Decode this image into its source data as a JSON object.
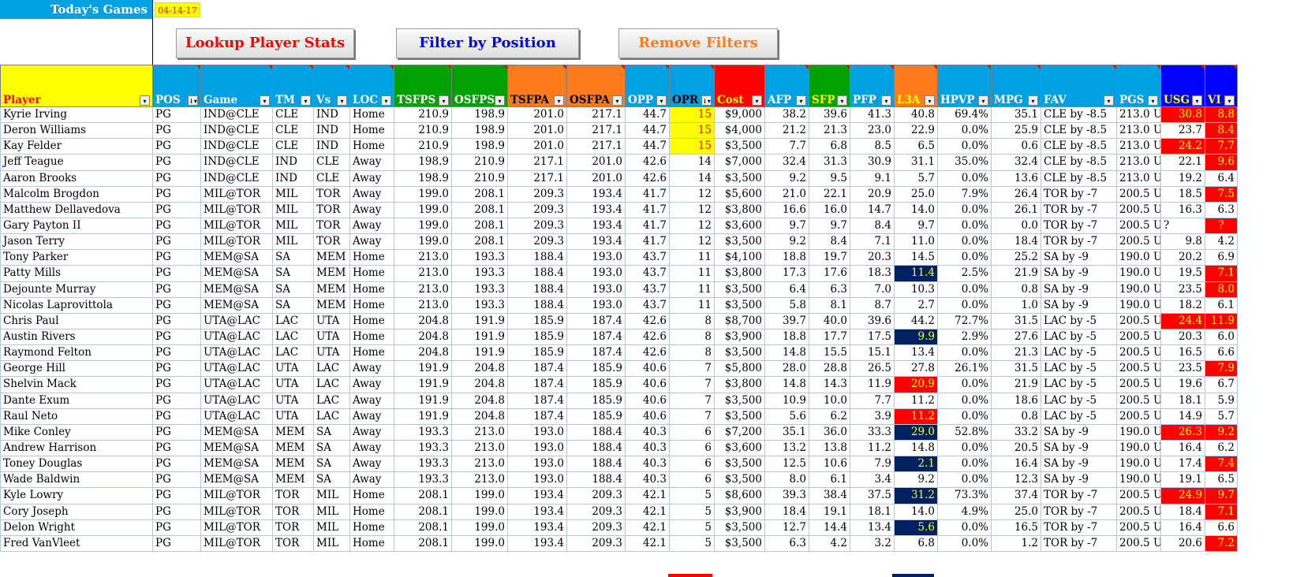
{
  "header": {
    "today_label": "Today's Games",
    "date": "04-14-17"
  },
  "buttons": {
    "lookup": "Lookup Player Stats",
    "filter": "Filter by Position",
    "remove": "Remove Filters"
  },
  "colors": {
    "header_blue": "#00a0e3",
    "header_yellow": "#ffff00",
    "header_green": "#00a000",
    "header_orange": "#ff7a1a",
    "header_red": "#ff0000",
    "header_navy": "#0000ff",
    "highlight_navy": "#002060"
  },
  "columns": [
    {
      "label": "Player",
      "bg": "#ffff00",
      "fg": "#ff0000",
      "w": 193,
      "sort": false
    },
    {
      "label": "POS",
      "bg": "#00a0e3",
      "fg": "#ffffff",
      "w": 61,
      "sort": true
    },
    {
      "label": "Game",
      "bg": "#00a0e3",
      "fg": "#ffffff",
      "w": 91,
      "sort": false
    },
    {
      "label": "TM",
      "bg": "#00a0e3",
      "fg": "#ffffff",
      "w": 52,
      "sort": false
    },
    {
      "label": "Vs",
      "bg": "#00a0e3",
      "fg": "#ffffff",
      "w": 46,
      "sort": false
    },
    {
      "label": "LOC",
      "bg": "#00a0e3",
      "fg": "#ffffff",
      "w": 56,
      "sort": false
    },
    {
      "label": "TSFPS",
      "bg": "#00a000",
      "fg": "#ffffff",
      "w": 73,
      "sort": false
    },
    {
      "label": "OSFPS",
      "bg": "#00a000",
      "fg": "#ffffff",
      "w": 71,
      "sort": false
    },
    {
      "label": "TSFPA",
      "bg": "#ff7a1a",
      "fg": "#000000",
      "w": 75,
      "sort": false
    },
    {
      "label": "OSFPA",
      "bg": "#ff7a1a",
      "fg": "#000000",
      "w": 74,
      "sort": false
    },
    {
      "label": "OPP",
      "bg": "#00a0e3",
      "fg": "#ffffff",
      "w": 56,
      "sort": false
    },
    {
      "label": "OPR",
      "bg": "#00a0e3",
      "fg": "#000000",
      "w": 57,
      "sort": true
    },
    {
      "label": "Cost",
      "bg": "#ff0000",
      "fg": "#ffff00",
      "w": 64,
      "sort": false
    },
    {
      "label": "AFP",
      "bg": "#00a0e3",
      "fg": "#ffffff",
      "w": 56,
      "sort": false
    },
    {
      "label": "SFP",
      "bg": "#00a000",
      "fg": "#ffff00",
      "w": 52,
      "sort": false
    },
    {
      "label": "PFP",
      "bg": "#00a0e3",
      "fg": "#ffffff",
      "w": 56,
      "sort": false
    },
    {
      "label": "L3A",
      "bg": "#ff7a1a",
      "fg": "#ffff00",
      "w": 55,
      "sort": false
    },
    {
      "label": "HPVP",
      "bg": "#00a0e3",
      "fg": "#ffffff",
      "w": 68,
      "sort": false
    },
    {
      "label": "MPG",
      "bg": "#00a0e3",
      "fg": "#ffffff",
      "w": 63,
      "sort": false
    },
    {
      "label": "FAV",
      "bg": "#00a0e3",
      "fg": "#ffffff",
      "w": 96,
      "sort": false
    },
    {
      "label": "PGS",
      "bg": "#00a0e3",
      "fg": "#ffffff",
      "w": 56,
      "sort": false
    },
    {
      "label": "USG",
      "bg": "#0000ff",
      "fg": "#ffff00",
      "w": 56,
      "sort": false
    },
    {
      "label": "VI",
      "bg": "#0000ff",
      "fg": "#ffff00",
      "w": 41,
      "sort": false
    }
  ],
  "rows": [
    {
      "c": [
        "Kyrie Irving",
        "PG",
        "IND@CLE",
        "CLE",
        "IND",
        "Home",
        "210.9",
        "198.9",
        "201.0",
        "217.1",
        "44.7",
        "15",
        "$9,000",
        "38.2",
        "39.6",
        "41.3",
        "40.8",
        "69.4%",
        "35.1",
        "CLE by -8.5",
        "213.0 U",
        "30.8",
        "8.8"
      ],
      "opr": "yellow",
      "l3a": "",
      "usg": "red",
      "vi": "red"
    },
    {
      "c": [
        "Deron Williams",
        "PG",
        "IND@CLE",
        "CLE",
        "IND",
        "Home",
        "210.9",
        "198.9",
        "201.0",
        "217.1",
        "44.7",
        "15",
        "$4,000",
        "21.2",
        "21.3",
        "23.0",
        "22.9",
        "0.0%",
        "25.9",
        "CLE by -8.5",
        "213.0 U",
        "23.7",
        "8.4"
      ],
      "opr": "yellow",
      "l3a": "",
      "usg": "",
      "vi": "red"
    },
    {
      "c": [
        "Kay Felder",
        "PG",
        "IND@CLE",
        "CLE",
        "IND",
        "Home",
        "210.9",
        "198.9",
        "201.0",
        "217.1",
        "44.7",
        "15",
        "$3,500",
        "7.7",
        "6.8",
        "8.5",
        "6.5",
        "0.0%",
        "0.6",
        "CLE by -8.5",
        "213.0 U",
        "24.2",
        "7.7"
      ],
      "opr": "yellow",
      "l3a": "",
      "usg": "red",
      "vi": "red"
    },
    {
      "c": [
        "Jeff Teague",
        "PG",
        "IND@CLE",
        "IND",
        "CLE",
        "Away",
        "198.9",
        "210.9",
        "217.1",
        "201.0",
        "42.6",
        "14",
        "$7,000",
        "32.4",
        "31.3",
        "30.9",
        "31.1",
        "35.0%",
        "32.4",
        "CLE by -8.5",
        "213.0 U",
        "22.1",
        "9.6"
      ],
      "opr": "",
      "l3a": "",
      "usg": "",
      "vi": "red"
    },
    {
      "c": [
        "Aaron Brooks",
        "PG",
        "IND@CLE",
        "IND",
        "CLE",
        "Away",
        "198.9",
        "210.9",
        "217.1",
        "201.0",
        "42.6",
        "14",
        "$3,500",
        "9.2",
        "9.5",
        "9.1",
        "5.7",
        "0.0%",
        "13.6",
        "CLE by -8.5",
        "213.0 U",
        "19.2",
        "6.4"
      ],
      "opr": "",
      "l3a": "",
      "usg": "",
      "vi": ""
    },
    {
      "c": [
        "Malcolm Brogdon",
        "PG",
        "MIL@TOR",
        "MIL",
        "TOR",
        "Away",
        "199.0",
        "208.1",
        "209.3",
        "193.4",
        "41.7",
        "12",
        "$5,600",
        "21.0",
        "22.1",
        "20.9",
        "25.0",
        "7.9%",
        "26.4",
        "TOR by -7",
        "200.5 U",
        "18.5",
        "7.5"
      ],
      "opr": "",
      "l3a": "",
      "usg": "",
      "vi": "red"
    },
    {
      "c": [
        "Matthew Dellavedova",
        "PG",
        "MIL@TOR",
        "MIL",
        "TOR",
        "Away",
        "199.0",
        "208.1",
        "209.3",
        "193.4",
        "41.7",
        "12",
        "$3,800",
        "16.6",
        "16.0",
        "14.7",
        "14.0",
        "0.0%",
        "26.1",
        "TOR by -7",
        "200.5 U",
        "16.3",
        "6.3"
      ],
      "opr": "",
      "l3a": "",
      "usg": "",
      "vi": ""
    },
    {
      "c": [
        "Gary Payton II",
        "PG",
        "MIL@TOR",
        "MIL",
        "TOR",
        "Away",
        "199.0",
        "208.1",
        "209.3",
        "193.4",
        "41.7",
        "12",
        "$3,600",
        "9.7",
        "9.7",
        "8.4",
        "9.7",
        "0.0%",
        "0.0",
        "TOR by -7",
        "200.5 U",
        "?",
        "?"
      ],
      "opr": "",
      "l3a": "",
      "usg": "plain-left",
      "vi": "red-center"
    },
    {
      "c": [
        "Jason Terry",
        "PG",
        "MIL@TOR",
        "MIL",
        "TOR",
        "Away",
        "199.0",
        "208.1",
        "209.3",
        "193.4",
        "41.7",
        "12",
        "$3,500",
        "9.2",
        "8.4",
        "7.1",
        "11.0",
        "0.0%",
        "18.4",
        "TOR by -7",
        "200.5 U",
        "9.8",
        "4.2"
      ],
      "opr": "",
      "l3a": "",
      "usg": "",
      "vi": ""
    },
    {
      "c": [
        "Tony Parker",
        "PG",
        "MEM@SA",
        "SA",
        "MEM",
        "Home",
        "213.0",
        "193.3",
        "188.4",
        "193.0",
        "43.7",
        "11",
        "$4,100",
        "18.8",
        "19.7",
        "20.3",
        "14.5",
        "0.0%",
        "25.2",
        "SA by -9",
        "190.0 U",
        "20.2",
        "6.9"
      ],
      "opr": "",
      "l3a": "",
      "usg": "",
      "vi": ""
    },
    {
      "c": [
        "Patty Mills",
        "PG",
        "MEM@SA",
        "SA",
        "MEM",
        "Home",
        "213.0",
        "193.3",
        "188.4",
        "193.0",
        "43.7",
        "11",
        "$3,800",
        "17.3",
        "17.6",
        "18.3",
        "11.4",
        "2.5%",
        "21.9",
        "SA by -9",
        "190.0 U",
        "19.5",
        "7.1"
      ],
      "opr": "",
      "l3a": "navy",
      "usg": "",
      "vi": "red"
    },
    {
      "c": [
        "Dejounte Murray",
        "PG",
        "MEM@SA",
        "SA",
        "MEM",
        "Home",
        "213.0",
        "193.3",
        "188.4",
        "193.0",
        "43.7",
        "11",
        "$3,500",
        "6.4",
        "6.3",
        "7.0",
        "10.3",
        "0.0%",
        "0.8",
        "SA by -9",
        "190.0 U",
        "23.5",
        "8.0"
      ],
      "opr": "",
      "l3a": "",
      "usg": "",
      "vi": "red"
    },
    {
      "c": [
        "Nicolas Laprovittola",
        "PG",
        "MEM@SA",
        "SA",
        "MEM",
        "Home",
        "213.0",
        "193.3",
        "188.4",
        "193.0",
        "43.7",
        "11",
        "$3,500",
        "5.8",
        "8.1",
        "8.7",
        "2.7",
        "0.0%",
        "1.0",
        "SA by -9",
        "190.0 U",
        "18.2",
        "6.1"
      ],
      "opr": "",
      "l3a": "",
      "usg": "",
      "vi": ""
    },
    {
      "c": [
        "Chris Paul",
        "PG",
        "UTA@LAC",
        "LAC",
        "UTA",
        "Home",
        "204.8",
        "191.9",
        "185.9",
        "187.4",
        "42.6",
        "8",
        "$8,700",
        "39.7",
        "40.0",
        "39.6",
        "44.2",
        "72.7%",
        "31.5",
        "LAC by -5",
        "200.5 U",
        "24.4",
        "11.9"
      ],
      "opr": "",
      "l3a": "",
      "usg": "red",
      "vi": "red"
    },
    {
      "c": [
        "Austin Rivers",
        "PG",
        "UTA@LAC",
        "LAC",
        "UTA",
        "Home",
        "204.8",
        "191.9",
        "185.9",
        "187.4",
        "42.6",
        "8",
        "$3,900",
        "18.8",
        "17.7",
        "17.5",
        "9.9",
        "2.9%",
        "27.6",
        "LAC by -5",
        "200.5 U",
        "20.3",
        "6.0"
      ],
      "opr": "",
      "l3a": "navy",
      "usg": "",
      "vi": ""
    },
    {
      "c": [
        "Raymond Felton",
        "PG",
        "UTA@LAC",
        "LAC",
        "UTA",
        "Home",
        "204.8",
        "191.9",
        "185.9",
        "187.4",
        "42.6",
        "8",
        "$3,500",
        "14.8",
        "15.5",
        "15.1",
        "13.4",
        "0.0%",
        "21.3",
        "LAC by -5",
        "200.5 U",
        "16.5",
        "6.6"
      ],
      "opr": "",
      "l3a": "",
      "usg": "",
      "vi": ""
    },
    {
      "c": [
        "George Hill",
        "PG",
        "UTA@LAC",
        "UTA",
        "LAC",
        "Away",
        "191.9",
        "204.8",
        "187.4",
        "185.9",
        "40.6",
        "7",
        "$5,800",
        "28.0",
        "28.8",
        "26.5",
        "27.8",
        "26.1%",
        "31.5",
        "LAC by -5",
        "200.5 U",
        "23.5",
        "7.9"
      ],
      "opr": "",
      "l3a": "",
      "usg": "",
      "vi": "red"
    },
    {
      "c": [
        "Shelvin Mack",
        "PG",
        "UTA@LAC",
        "UTA",
        "LAC",
        "Away",
        "191.9",
        "204.8",
        "187.4",
        "185.9",
        "40.6",
        "7",
        "$3,800",
        "14.8",
        "14.3",
        "11.9",
        "20.9",
        "0.0%",
        "21.9",
        "LAC by -5",
        "200.5 U",
        "19.6",
        "6.7"
      ],
      "opr": "",
      "l3a": "red",
      "usg": "",
      "vi": ""
    },
    {
      "c": [
        "Dante Exum",
        "PG",
        "UTA@LAC",
        "UTA",
        "LAC",
        "Away",
        "191.9",
        "204.8",
        "187.4",
        "185.9",
        "40.6",
        "7",
        "$3,500",
        "10.9",
        "10.0",
        "7.7",
        "11.2",
        "0.0%",
        "18.6",
        "LAC by -5",
        "200.5 U",
        "18.1",
        "5.9"
      ],
      "opr": "",
      "l3a": "",
      "usg": "",
      "vi": ""
    },
    {
      "c": [
        "Raul Neto",
        "PG",
        "UTA@LAC",
        "UTA",
        "LAC",
        "Away",
        "191.9",
        "204.8",
        "187.4",
        "185.9",
        "40.6",
        "7",
        "$3,500",
        "5.6",
        "6.2",
        "3.9",
        "11.2",
        "0.0%",
        "0.8",
        "LAC by -5",
        "200.5 U",
        "14.9",
        "5.7"
      ],
      "opr": "",
      "l3a": "red",
      "usg": "",
      "vi": ""
    },
    {
      "c": [
        "Mike Conley",
        "PG",
        "MEM@SA",
        "MEM",
        "SA",
        "Away",
        "193.3",
        "213.0",
        "193.0",
        "188.4",
        "40.3",
        "6",
        "$7,200",
        "35.1",
        "36.0",
        "33.3",
        "29.0",
        "52.8%",
        "33.2",
        "SA by -9",
        "190.0 U",
        "26.3",
        "9.2"
      ],
      "opr": "",
      "l3a": "navy",
      "usg": "red",
      "vi": "red"
    },
    {
      "c": [
        "Andrew Harrison",
        "PG",
        "MEM@SA",
        "MEM",
        "SA",
        "Away",
        "193.3",
        "213.0",
        "193.0",
        "188.4",
        "40.3",
        "6",
        "$3,600",
        "13.2",
        "13.8",
        "11.2",
        "14.8",
        "0.0%",
        "20.5",
        "SA by -9",
        "190.0 U",
        "16.4",
        "6.2"
      ],
      "opr": "",
      "l3a": "",
      "usg": "",
      "vi": ""
    },
    {
      "c": [
        "Toney Douglas",
        "PG",
        "MEM@SA",
        "MEM",
        "SA",
        "Away",
        "193.3",
        "213.0",
        "193.0",
        "188.4",
        "40.3",
        "6",
        "$3,500",
        "12.5",
        "10.6",
        "7.9",
        "2.1",
        "0.0%",
        "16.4",
        "SA by -9",
        "190.0 U",
        "17.4",
        "7.4"
      ],
      "opr": "",
      "l3a": "navy",
      "usg": "",
      "vi": "red"
    },
    {
      "c": [
        "Wade Baldwin",
        "PG",
        "MEM@SA",
        "MEM",
        "SA",
        "Away",
        "193.3",
        "213.0",
        "193.0",
        "188.4",
        "40.3",
        "6",
        "$3,500",
        "8.0",
        "6.1",
        "3.4",
        "9.2",
        "0.0%",
        "12.3",
        "SA by -9",
        "190.0 U",
        "19.1",
        "6.5"
      ],
      "opr": "",
      "l3a": "",
      "usg": "",
      "vi": ""
    },
    {
      "c": [
        "Kyle Lowry",
        "PG",
        "MIL@TOR",
        "TOR",
        "MIL",
        "Home",
        "208.1",
        "199.0",
        "193.4",
        "209.3",
        "42.1",
        "5",
        "$8,600",
        "39.3",
        "38.4",
        "37.5",
        "31.2",
        "73.3%",
        "37.4",
        "TOR by -7",
        "200.5 U",
        "24.9",
        "9.7"
      ],
      "opr": "",
      "l3a": "navy",
      "usg": "red",
      "vi": "red"
    },
    {
      "c": [
        "Cory Joseph",
        "PG",
        "MIL@TOR",
        "TOR",
        "MIL",
        "Home",
        "208.1",
        "199.0",
        "193.4",
        "209.3",
        "42.1",
        "5",
        "$3,900",
        "18.4",
        "19.1",
        "18.1",
        "14.0",
        "4.9%",
        "25.0",
        "TOR by -7",
        "200.5 U",
        "18.4",
        "7.1"
      ],
      "opr": "",
      "l3a": "",
      "usg": "",
      "vi": "red"
    },
    {
      "c": [
        "Delon Wright",
        "PG",
        "MIL@TOR",
        "TOR",
        "MIL",
        "Home",
        "208.1",
        "199.0",
        "193.4",
        "209.3",
        "42.1",
        "5",
        "$3,500",
        "12.7",
        "14.4",
        "13.4",
        "5.6",
        "0.0%",
        "16.5",
        "TOR by -7",
        "200.5 U",
        "16.4",
        "6.6"
      ],
      "opr": "",
      "l3a": "navy",
      "usg": "",
      "vi": ""
    },
    {
      "c": [
        "Fred VanVleet",
        "PG",
        "MIL@TOR",
        "TOR",
        "MIL",
        "Home",
        "208.1",
        "199.0",
        "193.4",
        "209.3",
        "42.1",
        "5",
        "$3,500",
        "6.3",
        "4.2",
        "3.2",
        "6.8",
        "0.0%",
        "1.2",
        "TOR by -7",
        "200.5 U",
        "20.6",
        "7.2"
      ],
      "opr": "",
      "l3a": "",
      "usg": "",
      "vi": "red"
    }
  ]
}
